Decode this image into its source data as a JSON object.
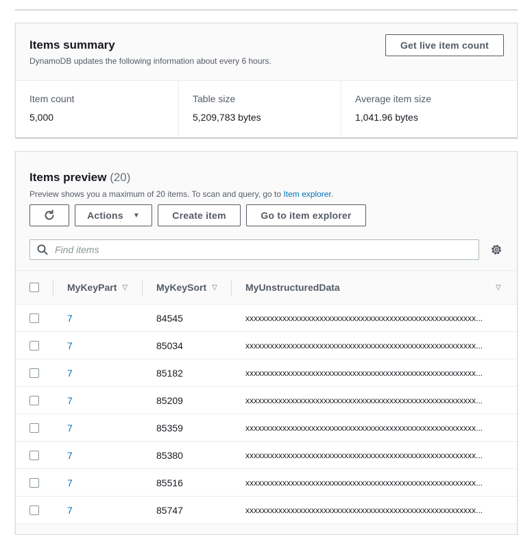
{
  "summary": {
    "title": "Items summary",
    "description": "DynamoDB updates the following information about every 6 hours.",
    "live_count_button": "Get live item count",
    "stats": [
      {
        "label": "Item count",
        "value": "5,000"
      },
      {
        "label": "Table size",
        "value": "5,209,783 bytes"
      },
      {
        "label": "Average item size",
        "value": "1,041.96 bytes"
      }
    ]
  },
  "preview": {
    "title": "Items preview",
    "count": "(20)",
    "description_prefix": "Preview shows you a maximum of 20 items. To scan and query, go to ",
    "description_link": "Item explorer",
    "description_suffix": ".",
    "buttons": {
      "refresh_icon": "refresh-icon",
      "actions": "Actions",
      "create": "Create item",
      "explorer": "Go to item explorer"
    },
    "search": {
      "placeholder": "Find items",
      "value": ""
    },
    "table": {
      "columns": [
        "MyKeyPart",
        "MyKeySort",
        "MyUnstructuredData"
      ],
      "rows": [
        {
          "key": "7",
          "sort": "84545",
          "data": "xxxxxxxxxxxxxxxxxxxxxxxxxxxxxxxxxxxxxxxxxxxxxxxxxxxxxxxx..."
        },
        {
          "key": "7",
          "sort": "85034",
          "data": "xxxxxxxxxxxxxxxxxxxxxxxxxxxxxxxxxxxxxxxxxxxxxxxxxxxxxxxx..."
        },
        {
          "key": "7",
          "sort": "85182",
          "data": "xxxxxxxxxxxxxxxxxxxxxxxxxxxxxxxxxxxxxxxxxxxxxxxxxxxxxxxx..."
        },
        {
          "key": "7",
          "sort": "85209",
          "data": "xxxxxxxxxxxxxxxxxxxxxxxxxxxxxxxxxxxxxxxxxxxxxxxxxxxxxxxx..."
        },
        {
          "key": "7",
          "sort": "85359",
          "data": "xxxxxxxxxxxxxxxxxxxxxxxxxxxxxxxxxxxxxxxxxxxxxxxxxxxxxxxx..."
        },
        {
          "key": "7",
          "sort": "85380",
          "data": "xxxxxxxxxxxxxxxxxxxxxxxxxxxxxxxxxxxxxxxxxxxxxxxxxxxxxxxx..."
        },
        {
          "key": "7",
          "sort": "85516",
          "data": "xxxxxxxxxxxxxxxxxxxxxxxxxxxxxxxxxxxxxxxxxxxxxxxxxxxxxxxx..."
        },
        {
          "key": "7",
          "sort": "85747",
          "data": "xxxxxxxxxxxxxxxxxxxxxxxxxxxxxxxxxxxxxxxxxxxxxxxxxxxxxxxx..."
        }
      ]
    }
  },
  "colors": {
    "link": "#0073bb",
    "text": "#16191f",
    "muted": "#545b64",
    "border": "#aab7b8"
  }
}
